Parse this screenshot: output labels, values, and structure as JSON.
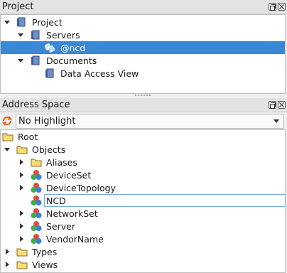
{
  "project_panel": {
    "title": "Project",
    "tree": {
      "root": "Project",
      "servers": "Servers",
      "ncd": "@ncd",
      "documents": "Documents",
      "data_access_view": "Data Access View"
    }
  },
  "address_panel": {
    "title": "Address Space",
    "highlight_select": {
      "value": "No Highlight"
    },
    "tree": {
      "root": "Root",
      "objects": "Objects",
      "aliases": "Aliases",
      "device_set": "DeviceSet",
      "device_topology": "DeviceTopology",
      "ncd": "NCD",
      "network_set": "NetworkSet",
      "server": "Server",
      "vendor_name": "VendorName",
      "types": "Types",
      "views": "Views"
    }
  },
  "colors": {
    "selection": "#3a87d6",
    "folder": "#f2c94c",
    "refresh": "#e0651f"
  }
}
